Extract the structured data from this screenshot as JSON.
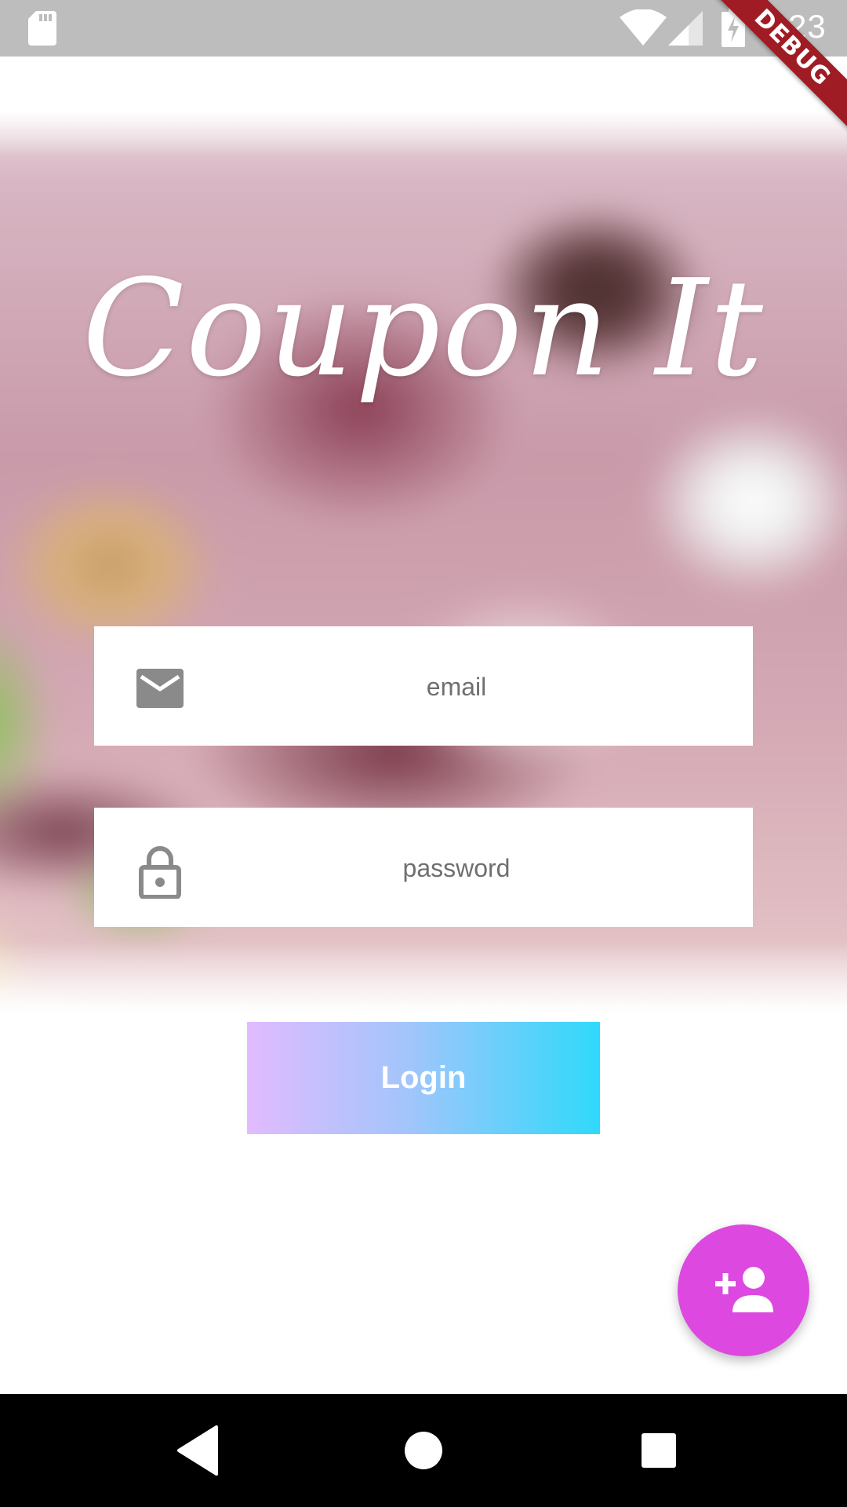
{
  "status_bar": {
    "time": "4:23",
    "icons": [
      "sd-card-icon",
      "wifi-icon",
      "signal-icon",
      "battery-charging-icon"
    ]
  },
  "debug_banner": {
    "label": "DEBUG"
  },
  "app": {
    "title": "Coupon It"
  },
  "login_form": {
    "email": {
      "placeholder": "email",
      "value": "",
      "icon": "mail-icon"
    },
    "password": {
      "placeholder": "password",
      "value": "",
      "icon": "lock-icon"
    },
    "login_label": "Login"
  },
  "fab": {
    "icon": "person-add-icon"
  },
  "nav_bar": {
    "icons": [
      "back-icon",
      "home-icon",
      "recents-icon"
    ]
  },
  "colors": {
    "status_bar": "#bdbdbd",
    "debug_ribbon": "#a01c25",
    "fab": "#dc48e0",
    "login_gradient_start": "#e1bbff",
    "login_gradient_end": "#2fd9fb",
    "icon_gray": "#8a8a8a"
  }
}
